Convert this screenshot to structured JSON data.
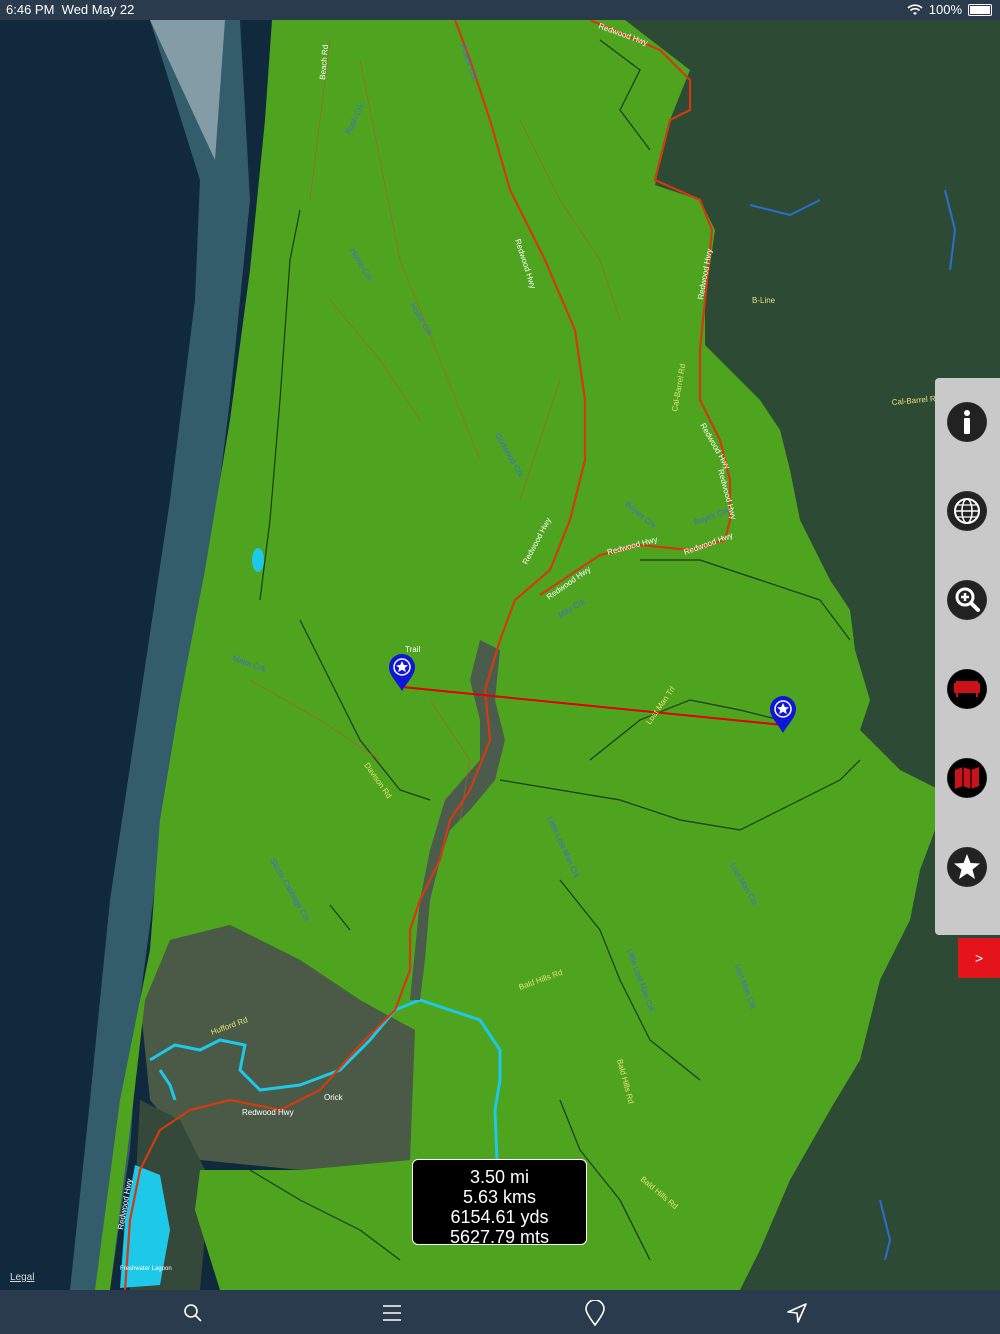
{
  "status": {
    "time": "6:46 PM",
    "date": "Wed May 22",
    "battery": "100%"
  },
  "distance": {
    "miles": "3.50 mi",
    "kms": "5.63 kms",
    "yards": "6154.61 yds",
    "meters": "5627.79 mts"
  },
  "legal_label": "Legal",
  "expand_label": ">",
  "colors": {
    "park": "#4ea41e",
    "ocean": "#10293d",
    "forest": "#2c4a34",
    "route": "#d23a12",
    "pin": "#1016d8",
    "toolbar": "#2b3b4e"
  },
  "map_labels": {
    "redwood_hwy": "Redwood Hwy",
    "b_line": "B-Line",
    "cal_barrel_rd": "Cal-Barrel Rd",
    "boyes_crk": "Boyes Crk",
    "may_crk": "May Crk",
    "major_crk": "Major Crk",
    "davison_rd": "Davison Rd",
    "lost_man_trl": "Lost Man Trl",
    "lost_man_crk": "Lost Man Crk",
    "little_lost_man_crk": "Little Lost Man Crk",
    "skunk_cabbage_crk": "Skunk Cabbage Crk",
    "bald_hills_rd": "Bald Hills Rd",
    "hufford_rd": "Hufford Rd",
    "orick": "Orick",
    "home_crk": "Home Crk",
    "rush_crk": "Rush Crk",
    "prairie_crk": "Prairie Crk",
    "godwood_crk": "Godwood Crk",
    "trail": "Trail",
    "beach_rd": "Beach Rd",
    "freshwater_lagoon": "Freshwater Lagoon"
  },
  "side_buttons": [
    {
      "icon": "info-icon"
    },
    {
      "icon": "globe-icon"
    },
    {
      "icon": "zoom-in-icon"
    },
    {
      "icon": "trail-sign-icon"
    },
    {
      "icon": "map-icon"
    },
    {
      "icon": "star-icon"
    }
  ],
  "tabs": [
    {
      "icon": "search-icon"
    },
    {
      "icon": "menu-icon"
    },
    {
      "icon": "location-pin-icon"
    },
    {
      "icon": "navigation-arrow-icon"
    }
  ]
}
